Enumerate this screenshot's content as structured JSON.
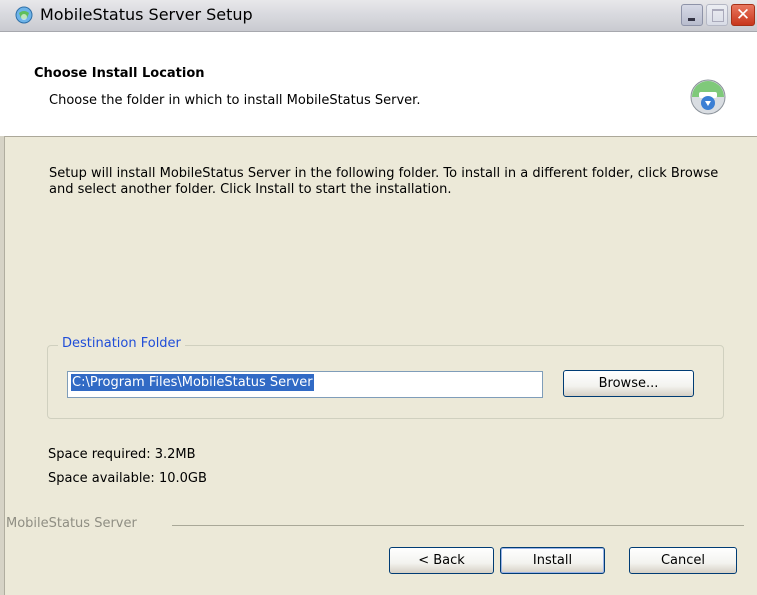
{
  "window": {
    "title": "MobileStatus Server Setup",
    "icon": "installer-globe-icon",
    "buttons": [
      "minimize",
      "maximize",
      "close"
    ]
  },
  "header": {
    "title": "Choose Install Location",
    "subtitle": "Choose the folder in which to install MobileStatus Server.",
    "icon": "install-disc-icon"
  },
  "intro_text": "Setup will install MobileStatus Server in the following folder. To install in a different folder, click Browse and select another folder. Click Install to start the installation.",
  "destination": {
    "legend": "Destination Folder",
    "path": "C:\\Program Files\\MobileStatus Server",
    "browse_label": "Browse..."
  },
  "space": {
    "required": "Space required: 3.2MB",
    "available": "Space available: 10.0GB"
  },
  "branding": "MobileStatus Server",
  "footer": {
    "back_label": "< Back",
    "install_label": "Install",
    "cancel_label": "Cancel"
  }
}
